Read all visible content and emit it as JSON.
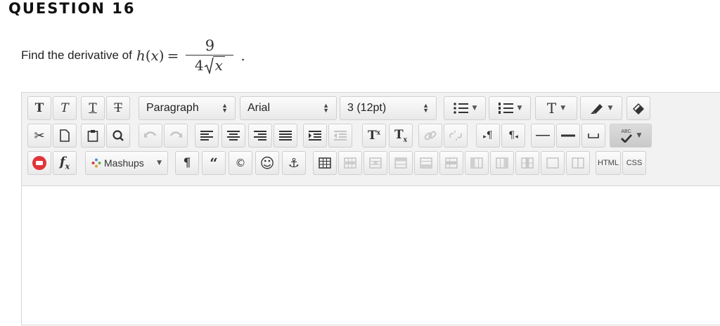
{
  "question": {
    "title": "QUESTION 16"
  },
  "prompt": {
    "text": "Find the derivative of",
    "func": "h",
    "lparen": "(",
    "var": "x",
    "rparen": ")",
    "equals": "=",
    "numerator": "9",
    "den_coef": "4",
    "radicand": "x",
    "period": "."
  },
  "toolbar": {
    "paragraph": "Paragraph",
    "font": "Arial",
    "size": "3 (12pt)",
    "mashups": "Mashups",
    "html_label": "HTML",
    "css_label": "CSS",
    "fx_label": "f",
    "fx_sub": "x",
    "spell_label": "ABC"
  }
}
